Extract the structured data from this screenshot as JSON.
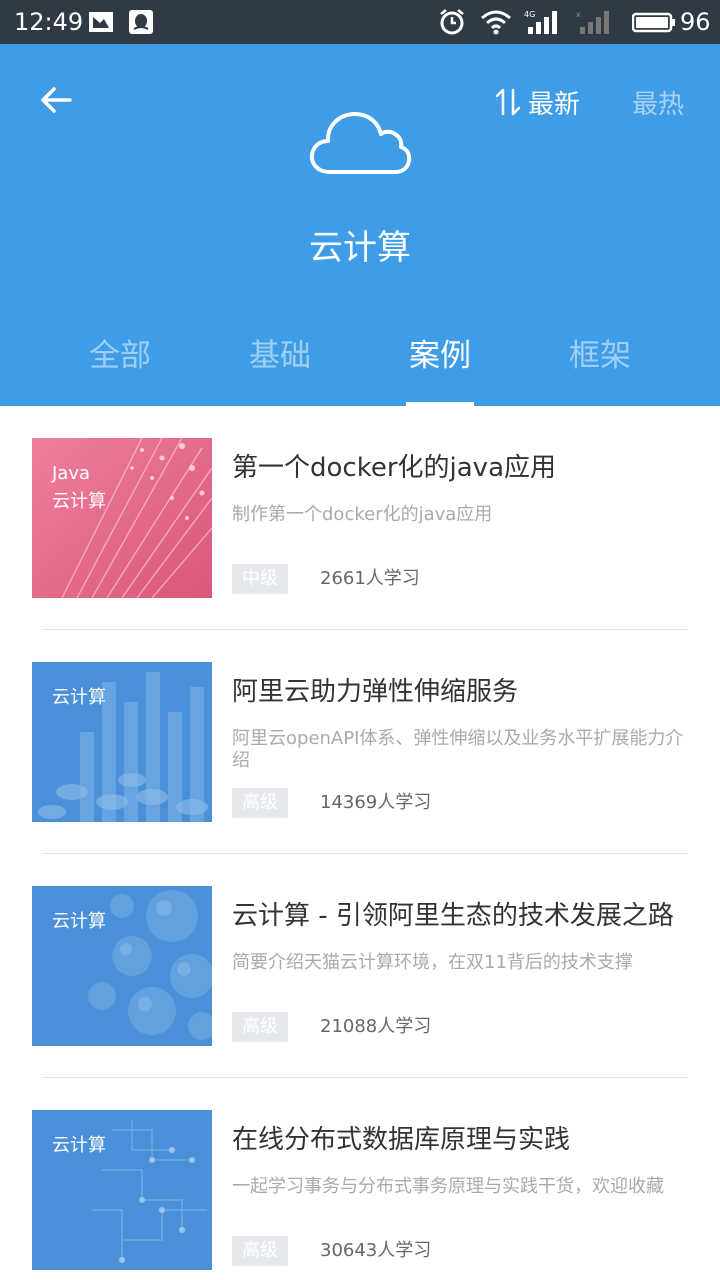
{
  "status_bar": {
    "time": "12:49",
    "battery": "96",
    "icons": [
      "image-notification-icon",
      "qq-notification-icon",
      "alarm-icon",
      "wifi-icon",
      "signal-4g-icon",
      "signal-empty-icon",
      "battery-icon"
    ]
  },
  "header": {
    "background": "#3f9de8",
    "back_icon": "arrow-left-icon",
    "sort": {
      "icon": "sort-arrows-icon",
      "latest_label": "最新",
      "hot_label": "最热",
      "active": "最新"
    },
    "category_icon": "cloud-icon",
    "category_title": "云计算"
  },
  "tabs": [
    {
      "label": "全部",
      "active": false
    },
    {
      "label": "基础",
      "active": false
    },
    {
      "label": "案例",
      "active": true
    },
    {
      "label": "框架",
      "active": false
    }
  ],
  "courses": [
    {
      "thumb_lines": [
        "Java",
        "云计算"
      ],
      "thumb_color": "#e96a8a",
      "title": "第一个docker化的java应用",
      "description": "制作第一个docker化的java应用",
      "level": "中级",
      "learners": "2661人学习"
    },
    {
      "thumb_lines": [
        "云计算"
      ],
      "thumb_color": "#4a90d9",
      "title": "阿里云助力弹性伸缩服务",
      "description": "阿里云openAPI体系、弹性伸缩以及业务水平扩展能力介绍",
      "level": "高级",
      "learners": "14369人学习"
    },
    {
      "thumb_lines": [
        "云计算"
      ],
      "thumb_color": "#4a90d9",
      "title": "云计算 - 引领阿里生态的技术发展之路",
      "description": "简要介绍天猫云计算环境，在双11背后的技术支撑",
      "level": "高级",
      "learners": "21088人学习"
    },
    {
      "thumb_lines": [
        "云计算"
      ],
      "thumb_color": "#4a90d9",
      "title": "在线分布式数据库原理与实践",
      "description": "一起学习事务与分布式事务原理与实践干货，欢迎收藏",
      "level": "高级",
      "learners": "30643人学习"
    }
  ]
}
